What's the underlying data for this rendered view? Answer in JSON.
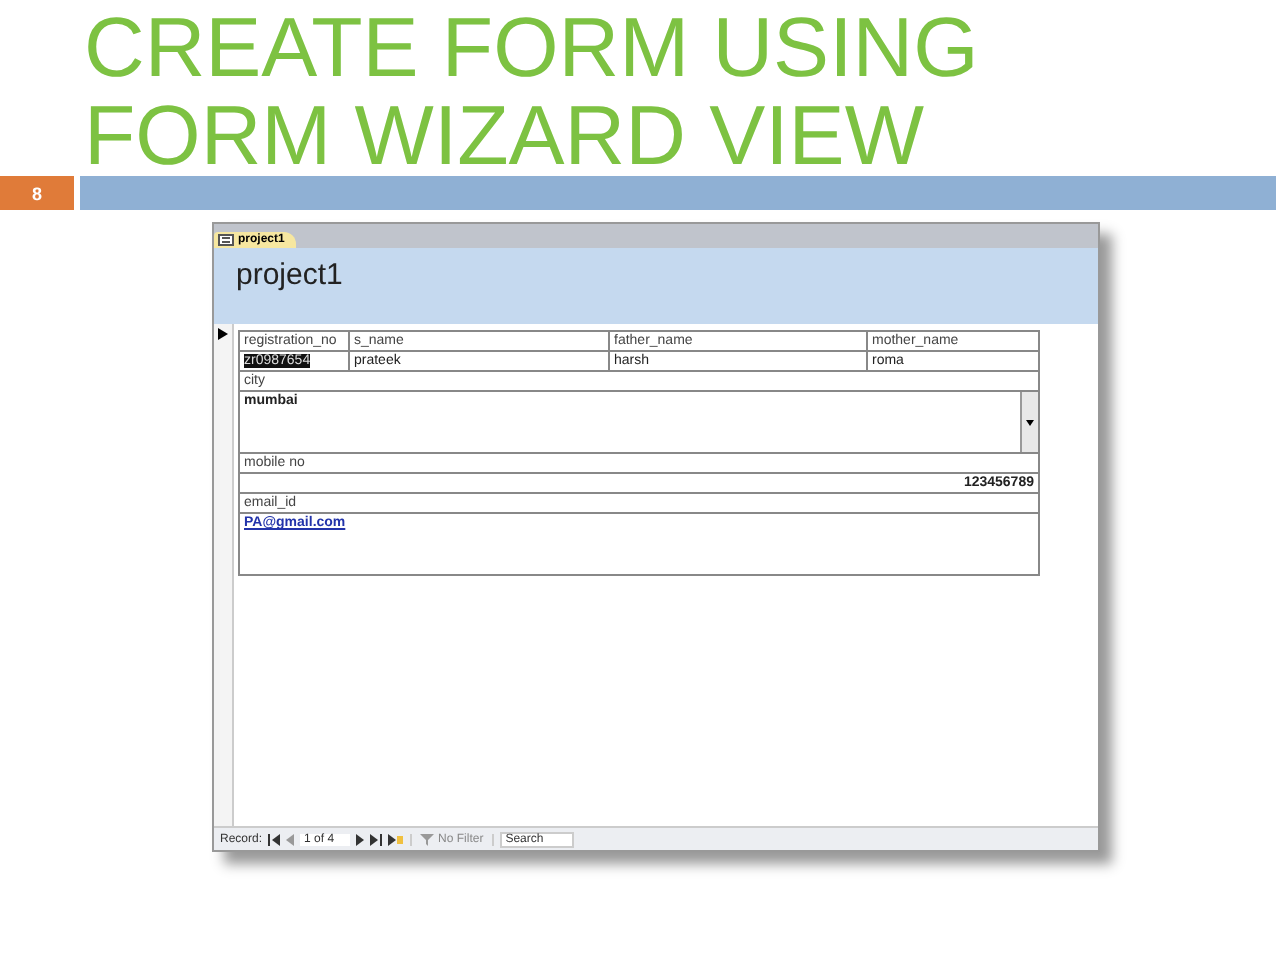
{
  "slide": {
    "title_lines": [
      "CREATE FORM USING",
      "FORM WIZARD VIEW"
    ],
    "number": "8"
  },
  "window": {
    "tab": "project1",
    "form_title": "project1"
  },
  "columns": [
    {
      "label": "registration_no",
      "value": "zr0987654",
      "selected": true
    },
    {
      "label": "s_name",
      "value": "prateek",
      "selected": false
    },
    {
      "label": "father_name",
      "value": "harsh",
      "selected": false
    },
    {
      "label": "mother_name",
      "value": "roma",
      "selected": false
    }
  ],
  "fields": [
    {
      "label": "city",
      "value": "mumbai",
      "kind": "combo"
    },
    {
      "label": "mobile no",
      "value": "123456789",
      "kind": "number"
    },
    {
      "label": "email_id",
      "value": "PA@gmail.com",
      "kind": "link"
    }
  ],
  "status_bar": {
    "label": "Record:",
    "position": "1 of 4",
    "filter": "No Filter",
    "search": "Search"
  }
}
